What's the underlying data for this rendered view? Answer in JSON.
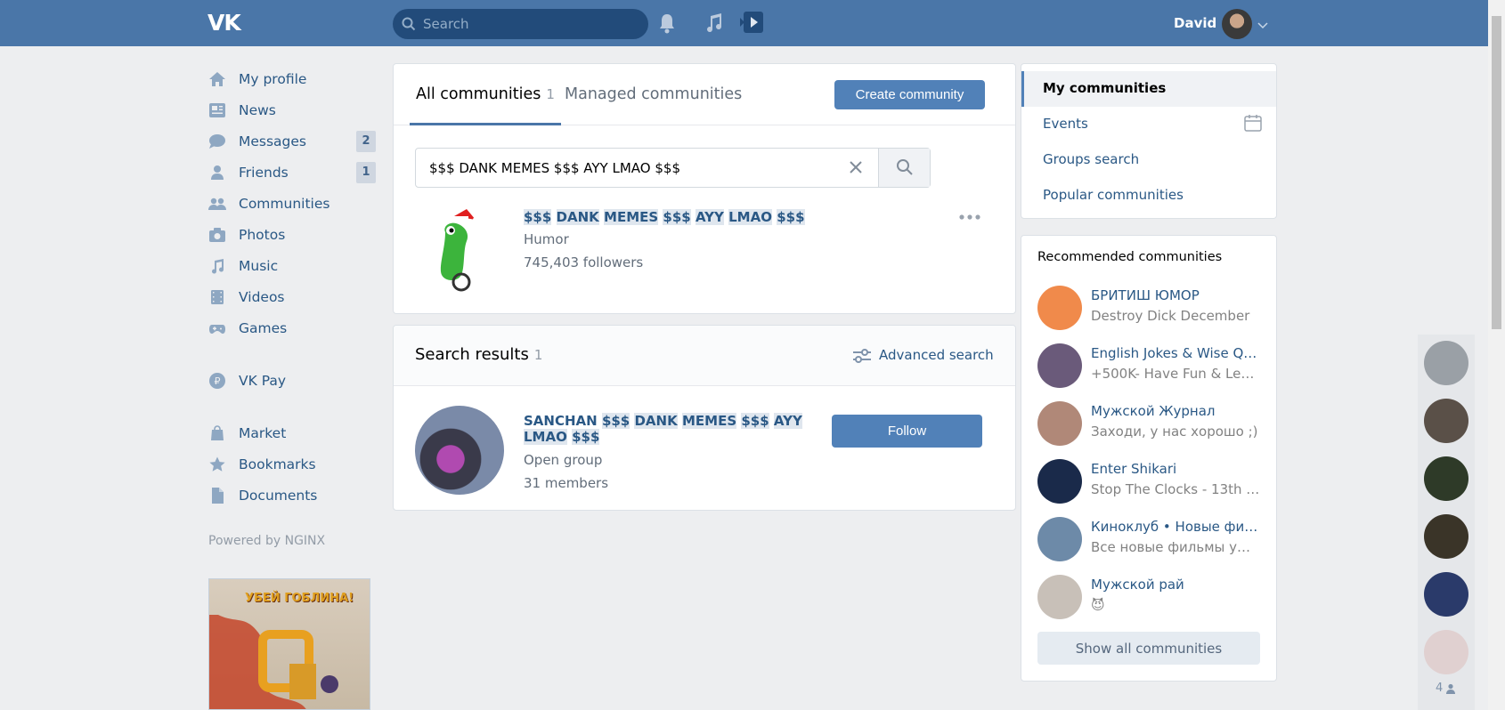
{
  "header": {
    "logo": "VK",
    "search_placeholder": "Search",
    "username": "David"
  },
  "left_nav": {
    "items": [
      {
        "label": "My profile"
      },
      {
        "label": "News"
      },
      {
        "label": "Messages",
        "badge": "2"
      },
      {
        "label": "Friends",
        "badge": "1"
      },
      {
        "label": "Communities"
      },
      {
        "label": "Photos"
      },
      {
        "label": "Music"
      },
      {
        "label": "Videos"
      },
      {
        "label": "Games"
      },
      {
        "label": "VK Pay"
      },
      {
        "label": "Market"
      },
      {
        "label": "Bookmarks"
      },
      {
        "label": "Documents"
      }
    ],
    "powered": "Powered by NGINX",
    "ad_text": "УБЕЙ ГОБЛИНА!"
  },
  "main": {
    "tabs": [
      {
        "label": "All communities",
        "count": "1"
      },
      {
        "label": "Managed communities"
      }
    ],
    "create_button": "Create community",
    "query": "$$$ DANK MEMES $$$ AYY LMAO $$$",
    "result": {
      "title_parts": [
        "$$$",
        "DANK",
        "MEMES",
        "$$$",
        "AYY",
        "LMAO",
        "$$$"
      ],
      "category": "Humor",
      "followers": "745,403 followers"
    },
    "search_results": {
      "title": "Search results",
      "count": "1",
      "advanced": "Advanced search",
      "item": {
        "name_prefix": "SANCHAN",
        "name_parts": [
          "$$$",
          "DANK",
          "MEMES",
          "$$$",
          "AYY",
          "LMAO",
          "$$$"
        ],
        "type": "Open group",
        "members": "31 members",
        "follow": "Follow"
      }
    }
  },
  "right_nav": {
    "items": [
      {
        "label": "My communities"
      },
      {
        "label": "Events"
      },
      {
        "label": "Groups search"
      },
      {
        "label": "Popular communities"
      }
    ]
  },
  "recommended": {
    "title": "Recommended communities",
    "items": [
      {
        "name": "БРИТИШ ЮМОР",
        "desc": "Destroy Dick December",
        "color": "#f08a4b"
      },
      {
        "name": "English Jokes & Wise Quo...",
        "desc": "+500K- Have Fun & Learn ...",
        "color": "#6a5a7a"
      },
      {
        "name": "Мужской Журнал",
        "desc": "Заходи, у нас хорошо ;)",
        "color": "#b08878"
      },
      {
        "name": "Enter Shikari",
        "desc": "Stop The Clocks - 13th Au...",
        "color": "#1a2a4a"
      },
      {
        "name": "Киноклуб • Новые филь...",
        "desc": "Все новые фильмы уже ...",
        "color": "#6d8aa8"
      },
      {
        "name": "Мужской рай",
        "desc": "😈",
        "color": "#c8c0b8"
      }
    ],
    "show_all": "Show all communities"
  },
  "chats": {
    "count": "4",
    "colors": [
      "#9aa0a6",
      "#5a5048",
      "#2e3a28",
      "#3a3428",
      "#2a3a6a",
      "#e0d0d0"
    ]
  }
}
